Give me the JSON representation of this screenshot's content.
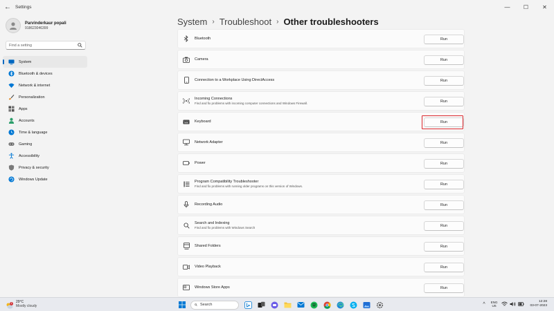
{
  "window": {
    "title": "Settings",
    "back_glyph": "←",
    "minimize_glyph": "—",
    "maximize_glyph": "☐",
    "close_glyph": "✕"
  },
  "profile": {
    "name": "Parvinderkaur popali",
    "phone": "918623046399"
  },
  "search": {
    "placeholder": "Find a setting"
  },
  "sidebar": {
    "items": [
      {
        "label": "System",
        "icon": "monitor-icon",
        "active": true
      },
      {
        "label": "Bluetooth & devices",
        "icon": "bluetooth-icon"
      },
      {
        "label": "Network & internet",
        "icon": "wifi-icon"
      },
      {
        "label": "Personalization",
        "icon": "brush-icon"
      },
      {
        "label": "Apps",
        "icon": "apps-icon"
      },
      {
        "label": "Accounts",
        "icon": "person-icon"
      },
      {
        "label": "Time & language",
        "icon": "globe-clock-icon"
      },
      {
        "label": "Gaming",
        "icon": "gamepad-icon"
      },
      {
        "label": "Accessibility",
        "icon": "accessibility-icon"
      },
      {
        "label": "Privacy & security",
        "icon": "shield-icon"
      },
      {
        "label": "Windows Update",
        "icon": "update-icon"
      }
    ]
  },
  "breadcrumb": {
    "items": [
      "System",
      "Troubleshoot"
    ],
    "separator": "›",
    "current": "Other troubleshooters"
  },
  "troubleshooters": [
    {
      "title": "Bluetooth",
      "desc": "",
      "icon": "bluetooth-icon",
      "button": "Run"
    },
    {
      "title": "Camera",
      "desc": "",
      "icon": "camera-icon",
      "button": "Run"
    },
    {
      "title": "Connection to a Workplace Using DirectAccess",
      "desc": "",
      "icon": "phone-device-icon",
      "button": "Run"
    },
    {
      "title": "Incoming Connections",
      "desc": "Find and fix problems with incoming computer connections and Windows Firewall.",
      "icon": "antenna-icon",
      "button": "Run"
    },
    {
      "title": "Keyboard",
      "desc": "",
      "icon": "keyboard-icon",
      "button": "Run"
    },
    {
      "title": "Network Adapter",
      "desc": "",
      "icon": "network-adapter-icon",
      "button": "Run"
    },
    {
      "title": "Power",
      "desc": "",
      "icon": "battery-icon",
      "button": "Run"
    },
    {
      "title": "Program Compatibility Troubleshooter",
      "desc": "Find and fix problems with running older programs on this version of Windows.",
      "icon": "list-icon",
      "button": "Run"
    },
    {
      "title": "Recording Audio",
      "desc": "",
      "icon": "microphone-icon",
      "button": "Run"
    },
    {
      "title": "Search and Indexing",
      "desc": "Find and fix problems with Windows Search",
      "icon": "search-icon",
      "button": "Run"
    },
    {
      "title": "Shared Folders",
      "desc": "",
      "icon": "shared-folder-icon",
      "button": "Run"
    },
    {
      "title": "Video Playback",
      "desc": "",
      "icon": "video-icon",
      "button": "Run"
    },
    {
      "title": "Windows Store Apps",
      "desc": "",
      "icon": "store-icon",
      "button": "Run"
    }
  ],
  "highlighted_row": "Keyboard",
  "taskbar": {
    "weather_temp": "29°C",
    "weather_condition": "Mostly cloudy",
    "notification_count": "1",
    "search_placeholder": "Search",
    "language_primary": "ENG",
    "language_secondary": "US",
    "time": "12:28",
    "date": "03-07-2023",
    "chevron_glyph": "^"
  },
  "colors": {
    "accent": "#0067c0",
    "highlight_box": "#d9262b",
    "background": "#f3f3f3"
  }
}
